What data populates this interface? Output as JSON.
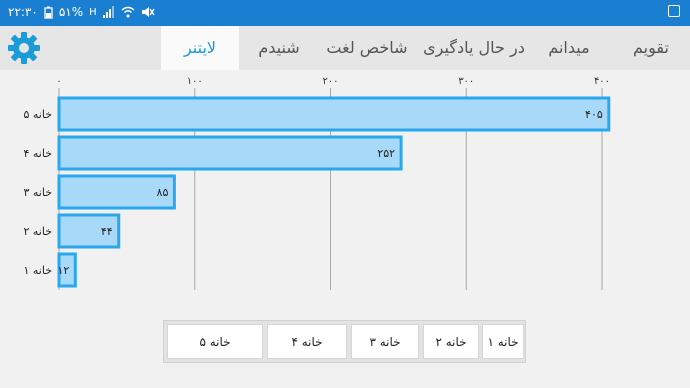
{
  "status_bar": {
    "time": "۲۲:۳۰",
    "battery": "۵۱%",
    "network": "H",
    "icons": [
      "battery-icon",
      "signal-icon",
      "wifi-icon",
      "mute-icon",
      "image-icon"
    ]
  },
  "tabs": [
    {
      "label": "تقویم",
      "active": false
    },
    {
      "label": "میدانم",
      "active": false
    },
    {
      "label": "در حال یادگیری",
      "active": false
    },
    {
      "label": "شاخص لغت",
      "active": false
    },
    {
      "label": "شنیدم",
      "active": false
    },
    {
      "label": "لایتنر",
      "active": true
    }
  ],
  "settings_icon": "gear-icon",
  "colors": {
    "status_bar": "#1b7fd1",
    "tab_active_text": "#1b9bd8",
    "bar_fill": "#a8d9f9",
    "bar_stroke": "#29a8ee"
  },
  "chart_data": {
    "type": "bar",
    "orientation": "horizontal",
    "categories": [
      "خانه ۵",
      "خانه ۴",
      "خانه ۳",
      "خانه ۲",
      "خانه ۱"
    ],
    "values": [
      405,
      252,
      85,
      44,
      12
    ],
    "value_labels": [
      "۴۰۵",
      "۲۵۲",
      "۸۵",
      "۴۴",
      "۱۲"
    ],
    "xlim": [
      0,
      400
    ],
    "xticks": [
      0,
      100,
      200,
      300,
      400
    ],
    "xtick_labels": [
      "۰",
      "۱۰۰",
      "۲۰۰",
      "۳۰۰",
      "۴۰۰"
    ],
    "grid": true
  },
  "legend": [
    {
      "label": "خانه ۱"
    },
    {
      "label": "خانه ۲"
    },
    {
      "label": "خانه ۳"
    },
    {
      "label": "خانه ۴"
    },
    {
      "label": "خانه ۵"
    }
  ]
}
